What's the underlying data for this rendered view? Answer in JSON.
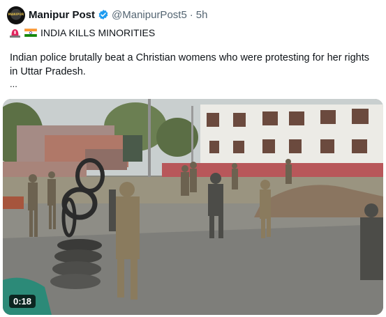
{
  "account": {
    "display_name": "Manipur Post",
    "handle": "@ManipurPost5",
    "separator": "·",
    "time": "5h",
    "avatar_icon": "manipur-post-logo-icon",
    "verified_icon": "verified-badge-icon",
    "verified_color": "#1d9bf0"
  },
  "post": {
    "headline_icons": [
      "police-siren-emoji-icon",
      "india-flag-emoji-icon"
    ],
    "headline": "INDIA KILLS MINORITIES",
    "text": "Indian police brutally beat a Christian womens who were protesting for her rights in Uttar Pradesh.",
    "more": "..."
  },
  "video": {
    "duration": "0:18"
  }
}
